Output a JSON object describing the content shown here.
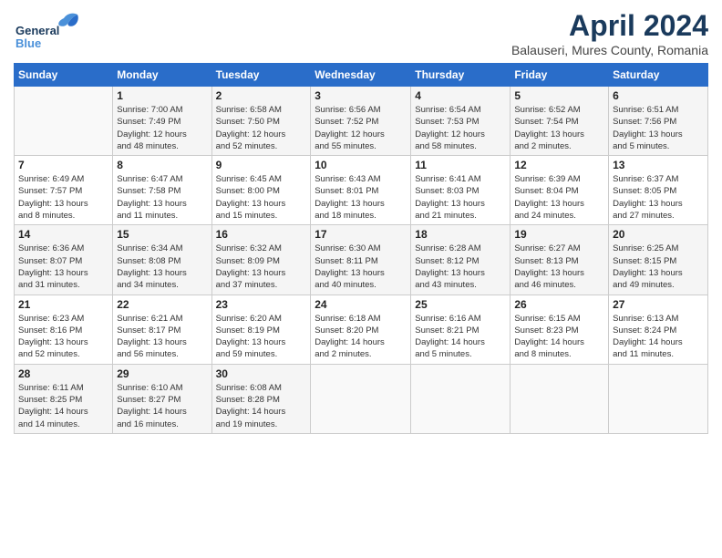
{
  "header": {
    "logo_line1": "General",
    "logo_line2": "Blue",
    "title": "April 2024",
    "subtitle": "Balauseri, Mures County, Romania"
  },
  "days_of_week": [
    "Sunday",
    "Monday",
    "Tuesday",
    "Wednesday",
    "Thursday",
    "Friday",
    "Saturday"
  ],
  "weeks": [
    [
      {
        "day": "",
        "info": ""
      },
      {
        "day": "1",
        "info": "Sunrise: 7:00 AM\nSunset: 7:49 PM\nDaylight: 12 hours\nand 48 minutes."
      },
      {
        "day": "2",
        "info": "Sunrise: 6:58 AM\nSunset: 7:50 PM\nDaylight: 12 hours\nand 52 minutes."
      },
      {
        "day": "3",
        "info": "Sunrise: 6:56 AM\nSunset: 7:52 PM\nDaylight: 12 hours\nand 55 minutes."
      },
      {
        "day": "4",
        "info": "Sunrise: 6:54 AM\nSunset: 7:53 PM\nDaylight: 12 hours\nand 58 minutes."
      },
      {
        "day": "5",
        "info": "Sunrise: 6:52 AM\nSunset: 7:54 PM\nDaylight: 13 hours\nand 2 minutes."
      },
      {
        "day": "6",
        "info": "Sunrise: 6:51 AM\nSunset: 7:56 PM\nDaylight: 13 hours\nand 5 minutes."
      }
    ],
    [
      {
        "day": "7",
        "info": "Sunrise: 6:49 AM\nSunset: 7:57 PM\nDaylight: 13 hours\nand 8 minutes."
      },
      {
        "day": "8",
        "info": "Sunrise: 6:47 AM\nSunset: 7:58 PM\nDaylight: 13 hours\nand 11 minutes."
      },
      {
        "day": "9",
        "info": "Sunrise: 6:45 AM\nSunset: 8:00 PM\nDaylight: 13 hours\nand 15 minutes."
      },
      {
        "day": "10",
        "info": "Sunrise: 6:43 AM\nSunset: 8:01 PM\nDaylight: 13 hours\nand 18 minutes."
      },
      {
        "day": "11",
        "info": "Sunrise: 6:41 AM\nSunset: 8:03 PM\nDaylight: 13 hours\nand 21 minutes."
      },
      {
        "day": "12",
        "info": "Sunrise: 6:39 AM\nSunset: 8:04 PM\nDaylight: 13 hours\nand 24 minutes."
      },
      {
        "day": "13",
        "info": "Sunrise: 6:37 AM\nSunset: 8:05 PM\nDaylight: 13 hours\nand 27 minutes."
      }
    ],
    [
      {
        "day": "14",
        "info": "Sunrise: 6:36 AM\nSunset: 8:07 PM\nDaylight: 13 hours\nand 31 minutes."
      },
      {
        "day": "15",
        "info": "Sunrise: 6:34 AM\nSunset: 8:08 PM\nDaylight: 13 hours\nand 34 minutes."
      },
      {
        "day": "16",
        "info": "Sunrise: 6:32 AM\nSunset: 8:09 PM\nDaylight: 13 hours\nand 37 minutes."
      },
      {
        "day": "17",
        "info": "Sunrise: 6:30 AM\nSunset: 8:11 PM\nDaylight: 13 hours\nand 40 minutes."
      },
      {
        "day": "18",
        "info": "Sunrise: 6:28 AM\nSunset: 8:12 PM\nDaylight: 13 hours\nand 43 minutes."
      },
      {
        "day": "19",
        "info": "Sunrise: 6:27 AM\nSunset: 8:13 PM\nDaylight: 13 hours\nand 46 minutes."
      },
      {
        "day": "20",
        "info": "Sunrise: 6:25 AM\nSunset: 8:15 PM\nDaylight: 13 hours\nand 49 minutes."
      }
    ],
    [
      {
        "day": "21",
        "info": "Sunrise: 6:23 AM\nSunset: 8:16 PM\nDaylight: 13 hours\nand 52 minutes."
      },
      {
        "day": "22",
        "info": "Sunrise: 6:21 AM\nSunset: 8:17 PM\nDaylight: 13 hours\nand 56 minutes."
      },
      {
        "day": "23",
        "info": "Sunrise: 6:20 AM\nSunset: 8:19 PM\nDaylight: 13 hours\nand 59 minutes."
      },
      {
        "day": "24",
        "info": "Sunrise: 6:18 AM\nSunset: 8:20 PM\nDaylight: 14 hours\nand 2 minutes."
      },
      {
        "day": "25",
        "info": "Sunrise: 6:16 AM\nSunset: 8:21 PM\nDaylight: 14 hours\nand 5 minutes."
      },
      {
        "day": "26",
        "info": "Sunrise: 6:15 AM\nSunset: 8:23 PM\nDaylight: 14 hours\nand 8 minutes."
      },
      {
        "day": "27",
        "info": "Sunrise: 6:13 AM\nSunset: 8:24 PM\nDaylight: 14 hours\nand 11 minutes."
      }
    ],
    [
      {
        "day": "28",
        "info": "Sunrise: 6:11 AM\nSunset: 8:25 PM\nDaylight: 14 hours\nand 14 minutes."
      },
      {
        "day": "29",
        "info": "Sunrise: 6:10 AM\nSunset: 8:27 PM\nDaylight: 14 hours\nand 16 minutes."
      },
      {
        "day": "30",
        "info": "Sunrise: 6:08 AM\nSunset: 8:28 PM\nDaylight: 14 hours\nand 19 minutes."
      },
      {
        "day": "",
        "info": ""
      },
      {
        "day": "",
        "info": ""
      },
      {
        "day": "",
        "info": ""
      },
      {
        "day": "",
        "info": ""
      }
    ]
  ]
}
